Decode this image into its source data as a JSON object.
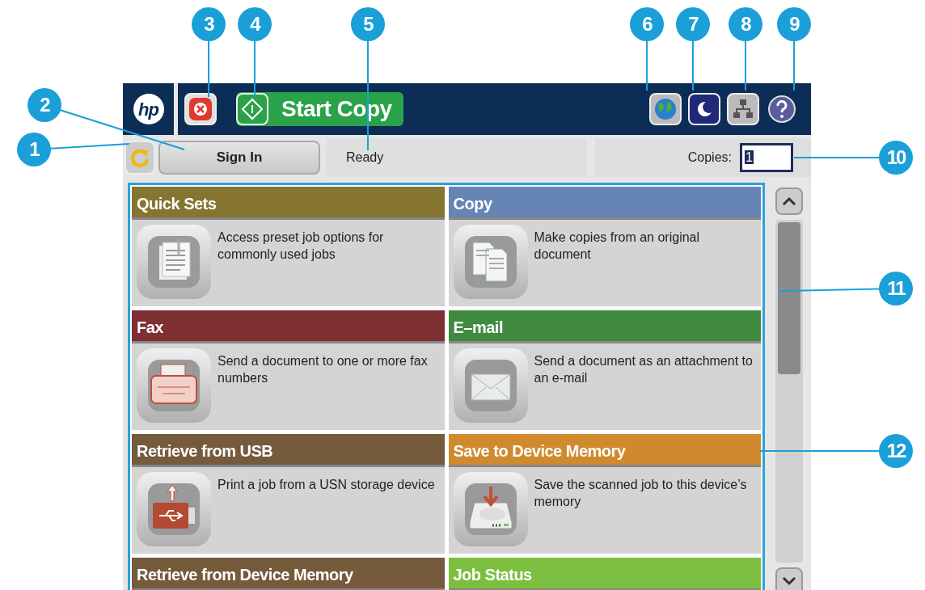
{
  "callouts": [
    "1",
    "2",
    "3",
    "4",
    "5",
    "6",
    "7",
    "8",
    "9",
    "10",
    "11",
    "12"
  ],
  "header": {
    "logo": "hp",
    "start_button": "Start Copy"
  },
  "status_bar": {
    "sign_in": "Sign In",
    "status": "Ready",
    "copies_label": "Copies:",
    "copies_value": "1"
  },
  "tiles": [
    {
      "title": "Quick Sets",
      "description": "Access preset job options for commonly used jobs",
      "color": "#857530"
    },
    {
      "title": "Copy",
      "description": "Make copies from an original document",
      "color": "#6684b4"
    },
    {
      "title": "Fax",
      "description": "Send a document to one or more fax numbers",
      "color": "#7e3032"
    },
    {
      "title": "E–mail",
      "description": "Send a document as an attachment to an e-mail",
      "color": "#3f8a3e"
    },
    {
      "title": "Retrieve from USB",
      "description": "Print a job from a USN storage device",
      "color": "#755a3c"
    },
    {
      "title": "Save to Device Memory",
      "description": "Save the scanned job to this device’s memory",
      "color": "#d08a2e"
    },
    {
      "title": "Retrieve from Device Memory",
      "color": "#755a3c"
    },
    {
      "title": "Job Status",
      "color": "#7cbf40"
    }
  ]
}
